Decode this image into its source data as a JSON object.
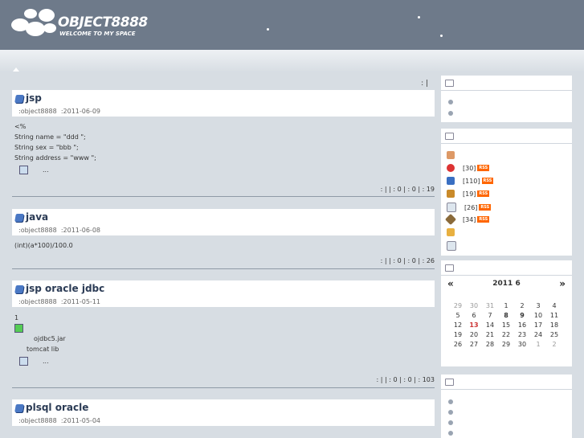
{
  "header": {
    "title": "OBJECT8888",
    "subtitle": "WELCOME TO MY SPACE"
  },
  "main": {
    "topbar": ":  |",
    "posts": [
      {
        "title": "jsp",
        "author": ":object8888",
        "date": ":2011-06-09",
        "body": [
          "<%",
          "String name = \"ddd \";",
          "String sex = \"bbb \";",
          "String address = \"www \";"
        ],
        "more": "...",
        "footer": ":  |     |  : 0 |  : 0 |     : 19"
      },
      {
        "title": "java",
        "author": ":object8888",
        "date": ":2011-06-08",
        "body": [
          "(int)(a*100)/100.0"
        ],
        "footer": ":  |     |  : 0 |  : 0 |     : 26"
      },
      {
        "title": "jsp    oracle       jdbc",
        "author": ":object8888",
        "date": ":2011-05-11",
        "body": [
          "1"
        ],
        "files": [
          "ojdbc5.jar",
          "tomcat lib"
        ],
        "more": "...",
        "footer": ":  |     |  : 0 |  : 0 |     : 103"
      },
      {
        "title": "plsql    oracle",
        "author": ":object8888",
        "date": ":2011-05-04"
      }
    ]
  },
  "sidebar": {
    "categories": [
      {
        "count": "[30]",
        "icon": "heart-icon",
        "color": "#d33"
      },
      {
        "count": "[110]",
        "icon": "book-icon",
        "color": "#3a6fc2"
      },
      {
        "count": "[19]",
        "icon": "box-icon",
        "color": "#c98a2a"
      },
      {
        "count": "[26]",
        "icon": "document-icon",
        "color": "#bcd"
      },
      {
        "count": "[34]",
        "icon": "diamond-icon",
        "color": "#8a6a3a"
      }
    ],
    "rss_label": "RSS",
    "calendar": {
      "title": "2011  6",
      "prev": "«",
      "next": "»",
      "days": [
        [
          "29",
          "30",
          "31",
          "1",
          "2",
          "3",
          "4"
        ],
        [
          "5",
          "6",
          "7",
          "8",
          "9",
          "10",
          "11"
        ],
        [
          "12",
          "13",
          "14",
          "15",
          "16",
          "17",
          "18"
        ],
        [
          "19",
          "20",
          "21",
          "22",
          "23",
          "24",
          "25"
        ],
        [
          "26",
          "27",
          "28",
          "29",
          "30",
          "1",
          "2"
        ]
      ]
    }
  },
  "colors": {
    "header_bg": "#6e7a8a",
    "page_bg": "#d7dde3",
    "title_color": "#2b3b55",
    "rss": "#ff6600"
  }
}
